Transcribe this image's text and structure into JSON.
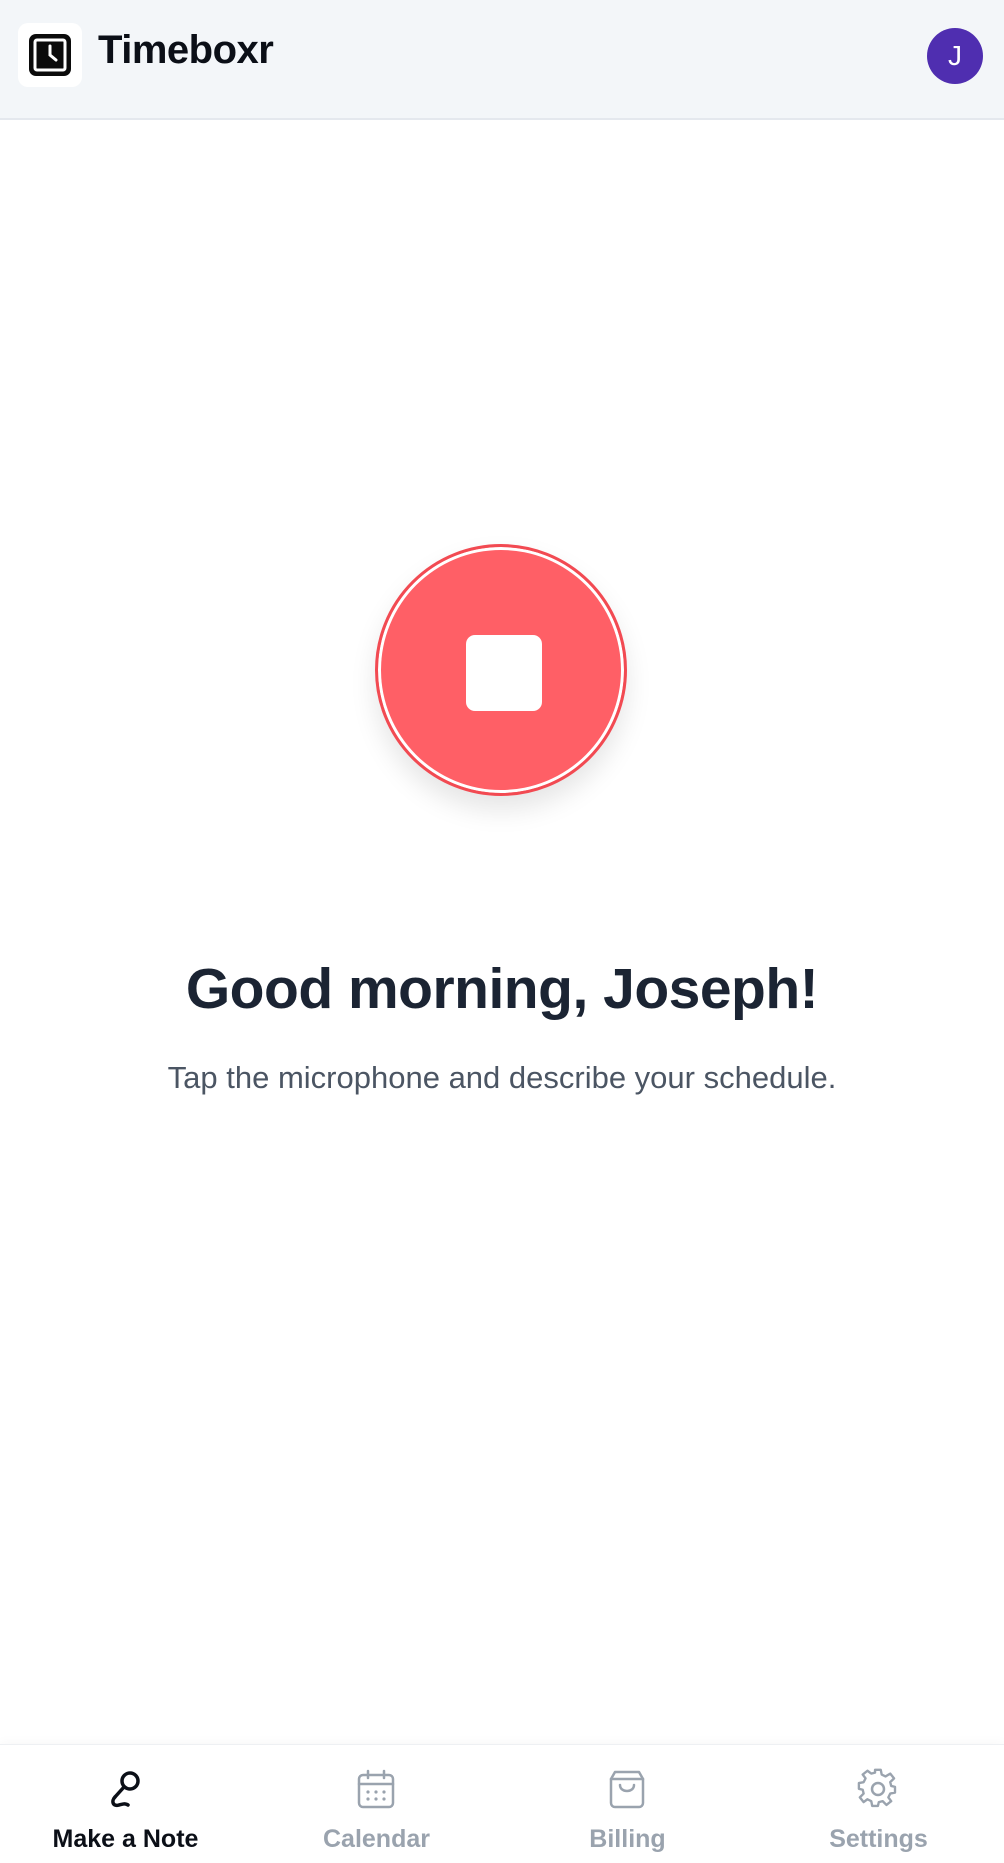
{
  "header": {
    "app_title": "Timeboxr",
    "logo_icon": "clock-icon",
    "avatar_initial": "J",
    "avatar_color": "#4f2eb0"
  },
  "main": {
    "record_button_icon": "stop-icon",
    "record_color": "#ff5f66",
    "greeting": "Good morning, Joseph!",
    "subtitle": "Tap the microphone and describe your schedule."
  },
  "nav": {
    "active": "make-a-note",
    "items": [
      {
        "label": "Make a Note",
        "icon": "microphone-icon"
      },
      {
        "label": "Calendar",
        "icon": "calendar-icon"
      },
      {
        "label": "Billing",
        "icon": "shopping-bag-icon"
      },
      {
        "label": "Settings",
        "icon": "gear-icon"
      }
    ]
  }
}
